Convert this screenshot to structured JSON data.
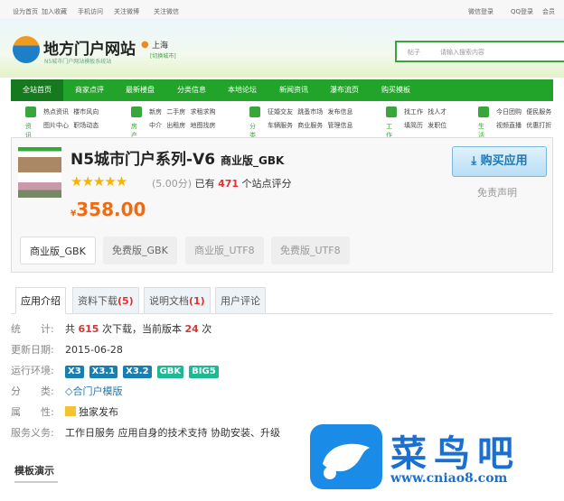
{
  "topbar": {
    "left": [
      "设为首页",
      "加入收藏",
      "手机访问",
      "关注微博",
      "关注微信"
    ],
    "right": [
      "微信登录",
      "QQ登录",
      "会员"
    ]
  },
  "header": {
    "logo": "地方门户网站",
    "logo_sub": "N5城市门户网站模板系统站",
    "city": "上海",
    "city_switch": "[切换城市]",
    "search_type": "帖子",
    "search_placeholder": "请输入搜索内容"
  },
  "nav": [
    "全站首页",
    "商家点评",
    "最新楼盘",
    "分类信息",
    "本地论坛",
    "新闻资讯",
    "瀑布流页",
    "购买模板"
  ],
  "subnav": [
    {
      "cap": "资讯",
      "r1": "热点资讯 楼市风向",
      "r2": "图片中心 职场动态"
    },
    {
      "cap": "房产",
      "r1": "新房 二手房 求租求购",
      "r2": "中介 出租房 地图找房"
    },
    {
      "cap": "分类",
      "r1": "征婚交友 跳蚤市场 发布信息",
      "r2": "车辆服务 商业服务 管理信息"
    },
    {
      "cap": "工作",
      "r1": "找工作 找人才",
      "r2": "填简历 发职位"
    },
    {
      "cap": "生活",
      "r1": "今日团购 便民服务",
      "r2": "视频直播 优惠打折"
    }
  ],
  "product": {
    "title": "N5城市门户系列-V6",
    "edition": "商业版_GBK",
    "stars": "★★★★★",
    "score": "(5.00分)",
    "rated_pre": "已有",
    "rated_count": "471",
    "rated_post": "个站点评分",
    "currency": "¥",
    "price": "358.00",
    "buy": "购买应用",
    "disclaimer": "免责声明",
    "versions": [
      "商业版_GBK",
      "免费版_GBK",
      "商业版_UTF8",
      "免费版_UTF8"
    ]
  },
  "tabs": [
    {
      "label": "应用介绍"
    },
    {
      "label": "资料下载",
      "count": "(5)"
    },
    {
      "label": "说明文档",
      "count": "(1)"
    },
    {
      "label": "用户评论"
    }
  ],
  "info": {
    "stat_label": "统　　计:",
    "stat_pre": "共",
    "downloads": "615",
    "stat_mid": "次下载，当前版本",
    "version_downloads": "24",
    "stat_post": "次",
    "date_label": "更新日期:",
    "date": "2015-06-28",
    "env_label": "运行环境:",
    "env": [
      "X3",
      "X3.1",
      "X3.2",
      "GBK",
      "BIG5"
    ],
    "cat_label": "分　　类:",
    "cat": "合门户模版",
    "attr_label": "属　　性:",
    "attr": "独家发布",
    "svc_label": "服务义务:",
    "svc": "工作日服务  应用自身的技术支持  协助安装、升级"
  },
  "demo": "模板演示",
  "watermark": {
    "text": "菜鸟吧",
    "url": "www.cniao8.com"
  },
  "colors": {
    "green": "#22a32a",
    "orange": "#f06a0f",
    "blue": "#1f78b4"
  }
}
